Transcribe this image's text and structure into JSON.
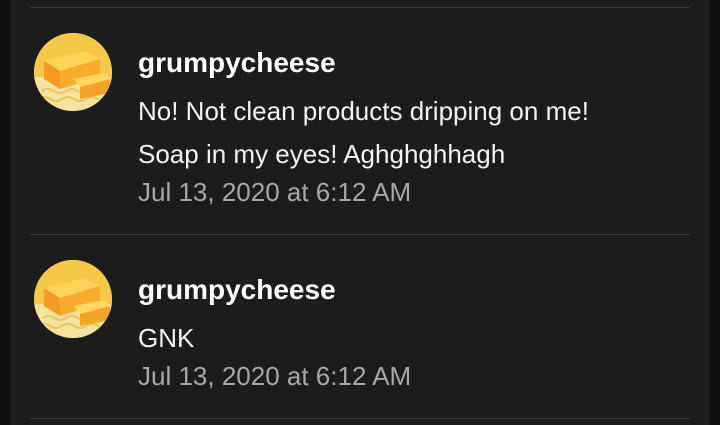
{
  "comments": [
    {
      "avatar_icon": "cheese-avatar-icon",
      "username": "grumpycheese",
      "lines": [
        "No! Not clean products dripping on me!",
        "Soap in my eyes! Aghghghhagh"
      ],
      "timestamp": "Jul 13, 2020 at 6:12 AM"
    },
    {
      "avatar_icon": "cheese-avatar-icon",
      "username": "grumpycheese",
      "lines": [
        "GNK"
      ],
      "timestamp": "Jul 13, 2020 at 6:12 AM"
    }
  ],
  "colors": {
    "background": "#1c1c1c",
    "username": "#ffffff",
    "text": "#f2f2f2",
    "timestamp": "#a8a8a8",
    "divider": "#3a3a3a"
  }
}
